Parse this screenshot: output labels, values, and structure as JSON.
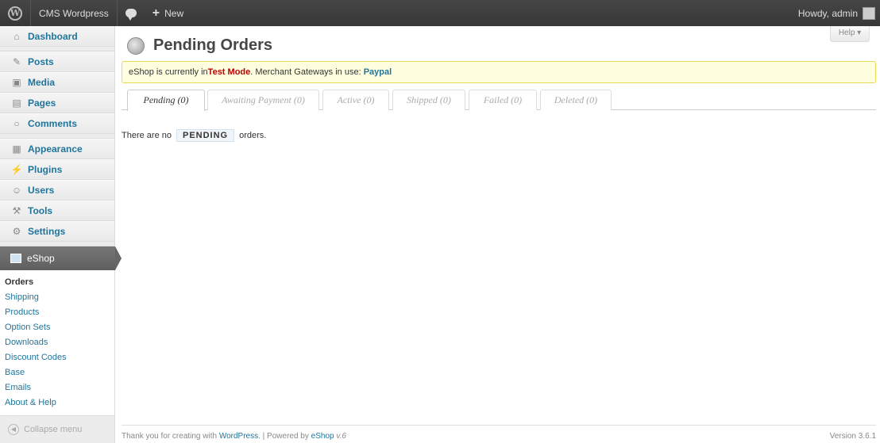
{
  "adminbar": {
    "site_name": "CMS Wordpress",
    "new_label": "New",
    "greeting": "Howdy, admin"
  },
  "sidebar": {
    "items": [
      {
        "label": "Dashboard",
        "icon": "home-icon"
      },
      {
        "label": "Posts",
        "icon": "pin-icon"
      },
      {
        "label": "Media",
        "icon": "media-icon"
      },
      {
        "label": "Pages",
        "icon": "pages-icon"
      },
      {
        "label": "Comments",
        "icon": "comments-icon"
      },
      {
        "label": "Appearance",
        "icon": "appearance-icon"
      },
      {
        "label": "Plugins",
        "icon": "plugins-icon"
      },
      {
        "label": "Users",
        "icon": "users-icon"
      },
      {
        "label": "Tools",
        "icon": "tools-icon"
      },
      {
        "label": "Settings",
        "icon": "settings-icon"
      }
    ],
    "current": {
      "label": "eShop"
    },
    "submenu": [
      "Orders",
      "Shipping",
      "Products",
      "Option Sets",
      "Downloads",
      "Discount Codes",
      "Base",
      "Emails",
      "About & Help"
    ],
    "collapse_label": "Collapse menu"
  },
  "main": {
    "help_label": "Help ▾",
    "title": "Pending Orders",
    "notice": {
      "prefix": "eShop is currently in ",
      "mode": "Test Mode",
      "middle": ". Merchant Gateways in use: ",
      "gateway": "Paypal"
    },
    "tabs": [
      "Pending (0)",
      "Awaiting Payment (0)",
      "Active (0)",
      "Shipped (0)",
      "Failed (0)",
      "Deleted (0)"
    ],
    "empty": {
      "prefix": "There are no",
      "status": "PENDING",
      "suffix": "orders."
    }
  },
  "footer": {
    "text1": "Thank you for creating with ",
    "wp_link": "WordPress",
    "text2": ". | Powered by ",
    "eshop_link": "eShop",
    "version_small": "v.6",
    "version": "Version 3.6.1"
  },
  "colors": {
    "link": "#21759b",
    "test_mode": "#bb0000",
    "notice_bg": "#ffffe0"
  }
}
